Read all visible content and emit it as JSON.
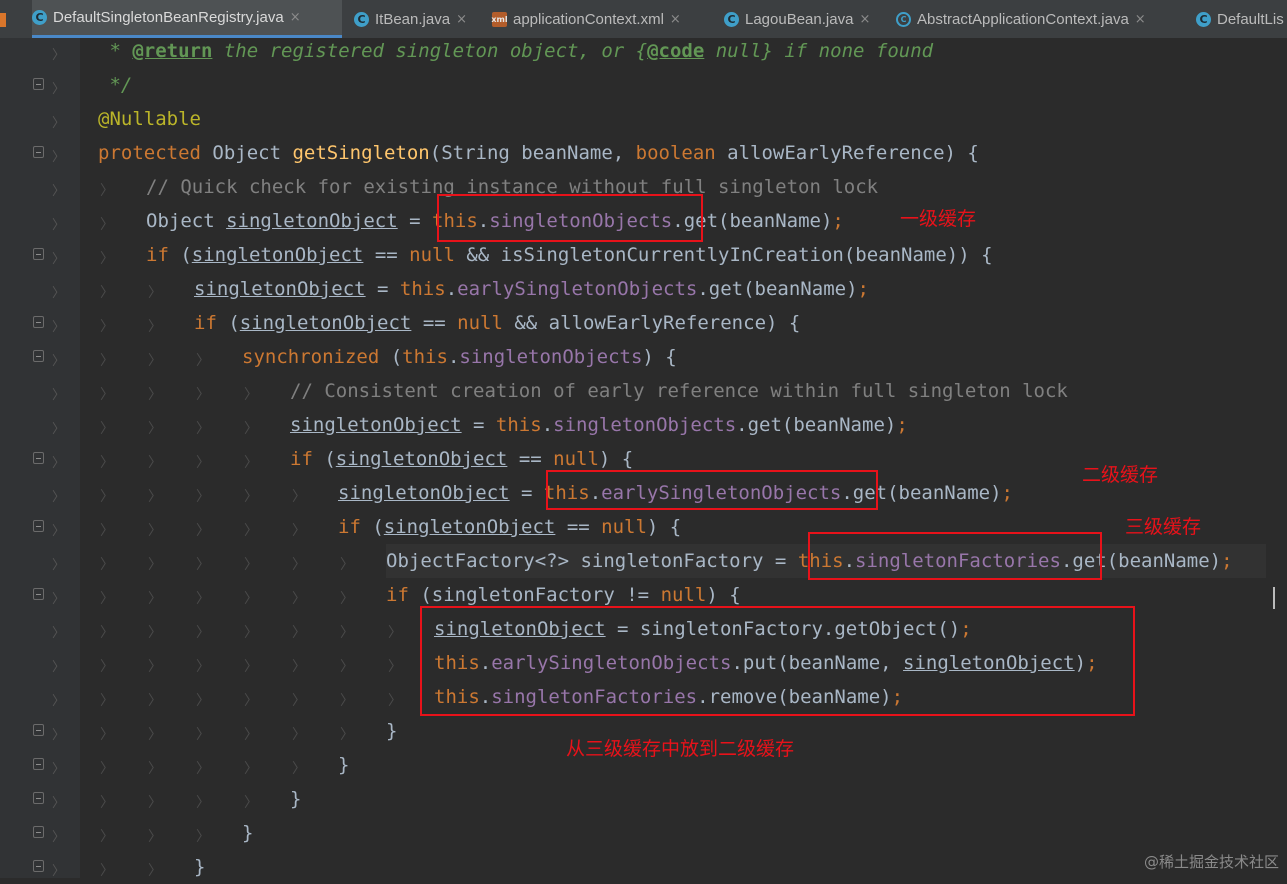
{
  "tabs": [
    {
      "label": "DefaultSingletonBeanRegistry.java",
      "icon": "class-icon",
      "active": true
    },
    {
      "label": "ItBean.java",
      "icon": "class-icon",
      "active": false
    },
    {
      "label": "applicationContext.xml",
      "icon": "xml-file-icon",
      "active": false
    },
    {
      "label": "LagouBean.java",
      "icon": "class-icon",
      "active": false
    },
    {
      "label": "AbstractApplicationContext.java",
      "icon": "abstract-class-icon",
      "active": false
    },
    {
      "label": "DefaultLis",
      "icon": "class-icon",
      "active": false
    }
  ],
  "tab_close_glyph": "×",
  "code": {
    "l1": {
      "star": " * ",
      "tag": "@return",
      "text": " the registered singleton object, or {",
      "code_tag": "@code",
      "tail": " null} if none found"
    },
    "l2": " */",
    "l3": "@Nullable",
    "l4": {
      "kw": "protected",
      "t1": " Object ",
      "fn": "getSingleton",
      "t2": "(String beanName, ",
      "kw2": "boolean",
      "t3": " allowEarlyReference) {"
    },
    "l5": "// Quick check for existing instance without full singleton lock",
    "l6": {
      "t1": "Object ",
      "var": "singletonObject",
      "t2": " = ",
      "kw": "this",
      "dot": ".",
      "field": "singletonObjects",
      "t3": ".get(beanName)",
      "semi": ";"
    },
    "l7": {
      "kw": "if",
      "t1": " (",
      "var": "singletonObject",
      "t2": " == ",
      "kw2": "null",
      "t3": " && isSingletonCurrentlyInCreation(beanName)) {"
    },
    "l8": {
      "var": "singletonObject",
      "t1": " = ",
      "kw": "this",
      "dot": ".",
      "field": "earlySingletonObjects",
      "t2": ".get(beanName)",
      "semi": ";"
    },
    "l9": {
      "kw": "if",
      "t1": " (",
      "var": "singletonObject",
      "t2": " == ",
      "kw2": "null",
      "t3": " && allowEarlyReference) {"
    },
    "l10": {
      "kw": "synchronized",
      "t1": " (",
      "kw2": "this",
      "dot": ".",
      "field": "singletonObjects",
      "t2": ") {"
    },
    "l11": "// Consistent creation of early reference within full singleton lock",
    "l12": {
      "var": "singletonObject",
      "t1": " = ",
      "kw": "this",
      "dot": ".",
      "field": "singletonObjects",
      "t2": ".get(beanName)",
      "semi": ";"
    },
    "l13": {
      "kw": "if",
      "t1": " (",
      "var": "singletonObject",
      "t2": " == ",
      "kw2": "null",
      "t3": ") {"
    },
    "l14": {
      "var": "singletonObject",
      "t1": " = ",
      "kw": "this",
      "dot": ".",
      "field": "earlySingletonObjects",
      "t2": ".get(beanName)",
      "semi": ";"
    },
    "l15": {
      "kw": "if",
      "t1": " (",
      "var": "singletonObject",
      "t2": " == ",
      "kw2": "null",
      "t3": ") {"
    },
    "l16": {
      "t1": "ObjectFactory<?> singletonFactory = ",
      "kw": "this",
      "dot": ".",
      "field": "singletonFactories",
      "t2": ".get(beanName)",
      "semi": ";"
    },
    "l17": {
      "kw": "if",
      "t1": " (singletonFactory != ",
      "kw2": "null",
      "t2": ") {"
    },
    "l18": {
      "var": "singletonObject",
      "t1": " = singletonFactory.getObject()",
      "semi": ";"
    },
    "l19": {
      "kw": "this",
      "dot": ".",
      "field": "earlySingletonObjects",
      "t1": ".put(beanName, ",
      "var": "singletonObject",
      "t2": ")",
      "semi": ";"
    },
    "l20": {
      "kw": "this",
      "dot": ".",
      "field": "singletonFactories",
      "t1": ".remove(beanName)",
      "semi": ";"
    },
    "brace": "}"
  },
  "annotations": {
    "level1": "一级缓存",
    "level2": "二级缓存",
    "level3": "三级缓存",
    "move": "从三级缓存中放到二级缓存"
  },
  "watermark": "@稀土掘金技术社区",
  "colors": {
    "annotation_red": "#e8121a",
    "keyword": "#cc7832",
    "field": "#9876aa",
    "method": "#ffc66d",
    "comment": "#808080",
    "doc": "#629755"
  }
}
